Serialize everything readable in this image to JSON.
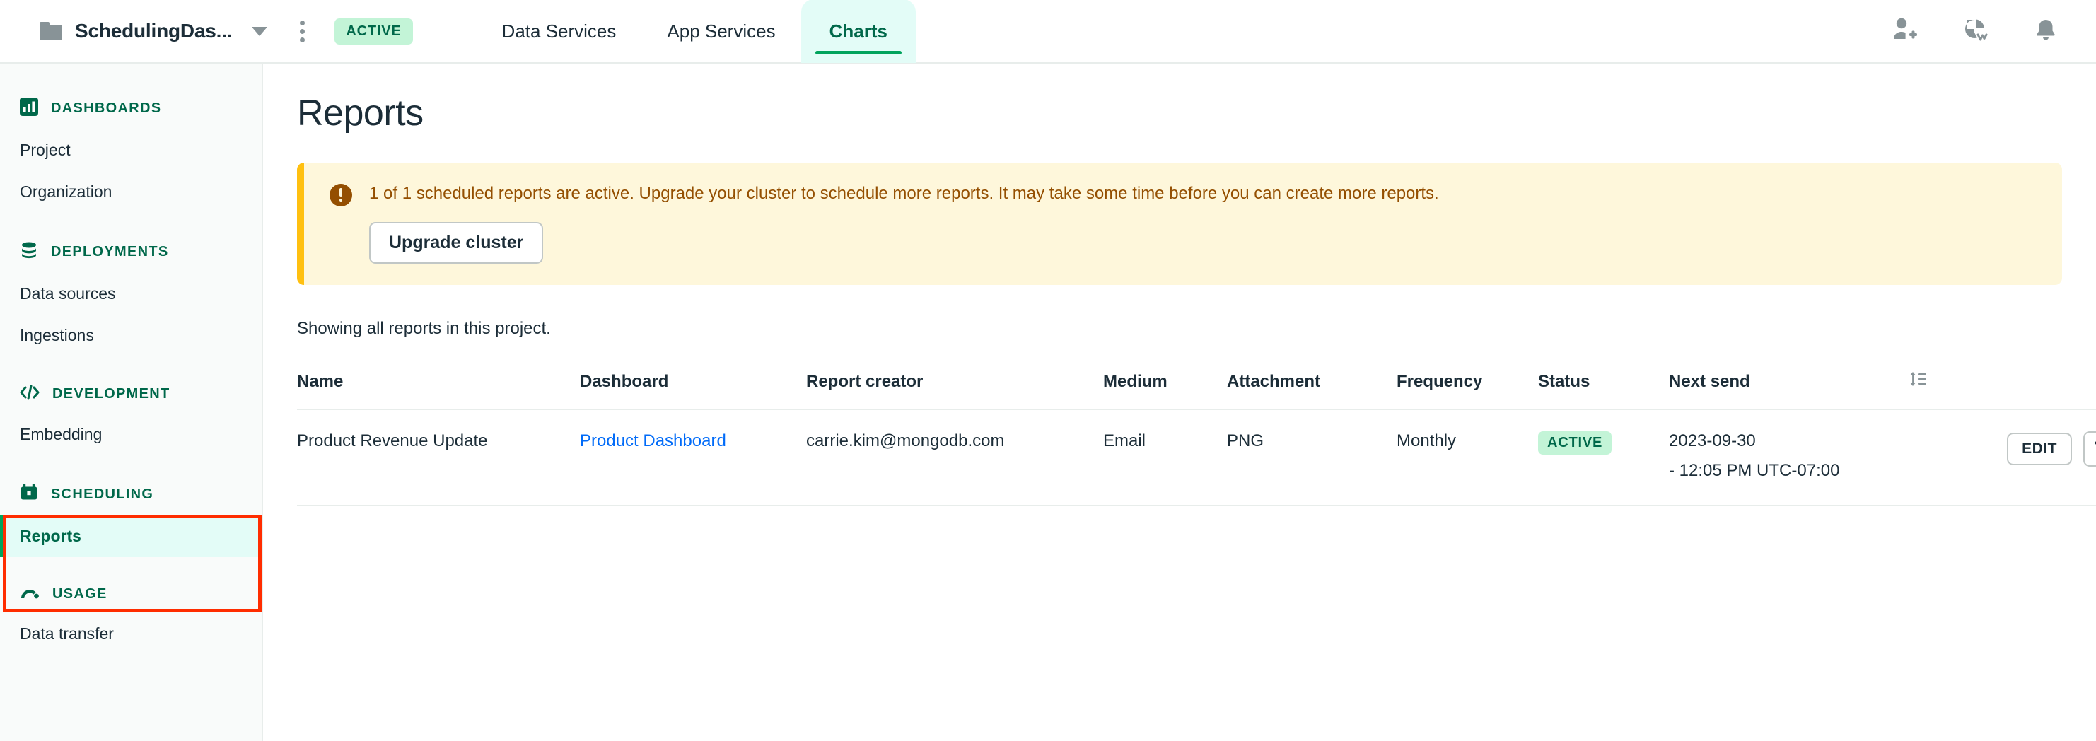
{
  "header": {
    "project_name": "SchedulingDas...",
    "folder_icon": "folder-icon",
    "caret_icon": "chevron-down-icon",
    "kebab_icon": "kebab-menu-icon",
    "status_badge": "ACTIVE",
    "tabs": [
      {
        "label": "Data Services",
        "active": false
      },
      {
        "label": "App Services",
        "active": false
      },
      {
        "label": "Charts",
        "active": true
      }
    ],
    "icons": [
      {
        "name": "invite-user-icon"
      },
      {
        "name": "activity-feed-icon"
      },
      {
        "name": "notification-bell-icon"
      }
    ]
  },
  "sidebar": {
    "sections": [
      {
        "title": "DASHBOARDS",
        "icon": "bar-chart-icon",
        "links": [
          {
            "label": "Project",
            "selected": false
          },
          {
            "label": "Organization",
            "selected": false
          }
        ]
      },
      {
        "title": "DEPLOYMENTS",
        "icon": "database-icon",
        "links": [
          {
            "label": "Data sources",
            "selected": false
          },
          {
            "label": "Ingestions",
            "selected": false
          }
        ]
      },
      {
        "title": "DEVELOPMENT",
        "icon": "code-brackets-icon",
        "links": [
          {
            "label": "Embedding",
            "selected": false
          }
        ]
      },
      {
        "title": "SCHEDULING",
        "icon": "calendar-icon",
        "links": [
          {
            "label": "Reports",
            "selected": true
          }
        ]
      },
      {
        "title": "USAGE",
        "icon": "gauge-icon",
        "links": [
          {
            "label": "Data transfer",
            "selected": false
          }
        ]
      }
    ]
  },
  "main": {
    "page_title": "Reports",
    "banner": {
      "icon": "warning-icon",
      "text": "1 of 1 scheduled reports are active. Upgrade your cluster to schedule more reports. It may take some time before you can create more reports.",
      "button_label": "Upgrade cluster"
    },
    "showing_text": "Showing all reports in this project.",
    "table": {
      "columns": [
        "Name",
        "Dashboard",
        "Report creator",
        "Medium",
        "Attachment",
        "Frequency",
        "Status",
        "Next send"
      ],
      "sort_icon": "sort-icon",
      "rows": [
        {
          "name": "Product Revenue Update",
          "dashboard": "Product Dashboard",
          "report_creator": "carrie.kim@mongodb.com",
          "medium": "Email",
          "attachment": "PNG",
          "frequency": "Monthly",
          "status": "ACTIVE",
          "next_send_date": "2023-09-30",
          "next_send_time": "- 12:05 PM UTC-07:00",
          "edit_label": "EDIT",
          "delete_icon": "trash-icon"
        }
      ]
    }
  },
  "colors": {
    "brand_green": "#00684A",
    "accent_green": "#00A35C",
    "mint": "#C3F4D7",
    "tab_mint": "#E3FCF7",
    "link_blue": "#016BF8",
    "banner_bg": "#FEF7DB",
    "banner_border": "#FFC010",
    "banner_text": "#944F01",
    "annotation_red": "#FF2D00",
    "text_dark": "#1C2D38",
    "sidebar_bg": "#F9FBFA"
  }
}
